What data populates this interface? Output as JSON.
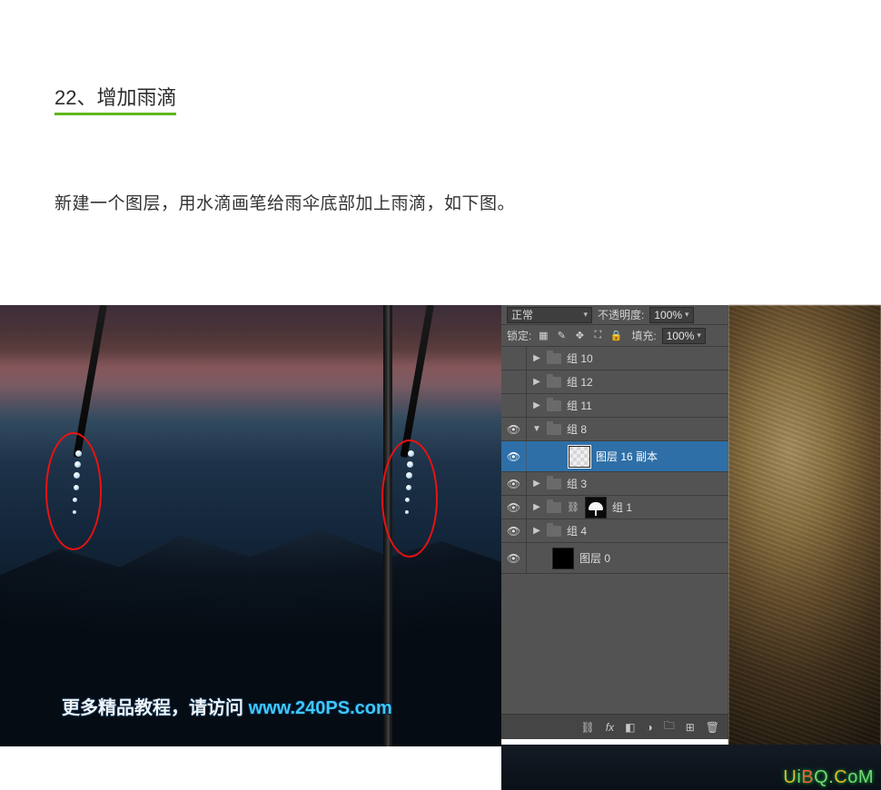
{
  "step": {
    "title": "22、增加雨滴"
  },
  "desc": "新建一个图层，用水滴画笔给雨伞底部加上雨滴，如下图。",
  "caption": {
    "prefix": "更多精品教程，请访问 ",
    "url": "www.240PS.com"
  },
  "watermark": "UiBQ.CoM",
  "panel": {
    "blend": {
      "mode": "正常",
      "opacity_label": "不透明度:",
      "opacity_value": "100%"
    },
    "lock": {
      "label": "锁定:",
      "fill_label": "填充:",
      "fill_value": "100%"
    },
    "layers": [
      {
        "id": "grp10",
        "type": "folder",
        "name": "组 10",
        "visible": false,
        "indent": 0,
        "collapsed": true
      },
      {
        "id": "grp12",
        "type": "folder",
        "name": "组 12",
        "visible": false,
        "indent": 0,
        "collapsed": true
      },
      {
        "id": "grp11",
        "type": "folder",
        "name": "组 11",
        "visible": false,
        "indent": 0,
        "collapsed": true
      },
      {
        "id": "grp8",
        "type": "folder",
        "name": "组 8",
        "visible": true,
        "indent": 0,
        "collapsed": false
      },
      {
        "id": "l16c",
        "type": "layer",
        "name": "图层 16 副本",
        "visible": true,
        "indent": 1,
        "selected": true,
        "thumb": "checker"
      },
      {
        "id": "grp3",
        "type": "folder",
        "name": "组 3",
        "visible": true,
        "indent": 0,
        "collapsed": true
      },
      {
        "id": "grp1",
        "type": "folder",
        "name": "组 1",
        "visible": true,
        "indent": 0,
        "collapsed": true,
        "linked": true,
        "mask": "umbrella"
      },
      {
        "id": "grp4",
        "type": "folder",
        "name": "组 4",
        "visible": true,
        "indent": 0,
        "collapsed": true
      },
      {
        "id": "l0",
        "type": "layer",
        "name": "图层 0",
        "visible": true,
        "indent": 0,
        "thumb": "black"
      }
    ]
  }
}
